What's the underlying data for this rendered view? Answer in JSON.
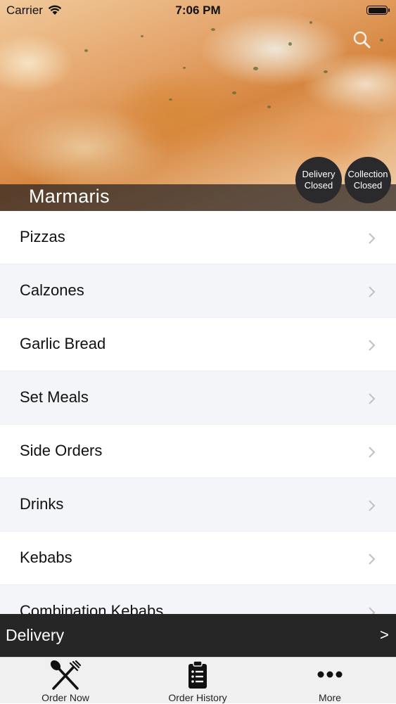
{
  "status_bar": {
    "carrier": "Carrier",
    "time": "7:06 PM"
  },
  "restaurant": {
    "name": "Marmaris"
  },
  "status": {
    "delivery": {
      "line1": "Delivery",
      "line2": "Closed"
    },
    "collection": {
      "line1": "Collection",
      "line2": "Closed"
    }
  },
  "menu": {
    "items": [
      {
        "label": "Pizzas"
      },
      {
        "label": "Calzones"
      },
      {
        "label": "Garlic Bread"
      },
      {
        "label": "Set Meals"
      },
      {
        "label": "Side Orders"
      },
      {
        "label": "Drinks"
      },
      {
        "label": "Kebabs"
      },
      {
        "label": "Combination Kebabs"
      }
    ]
  },
  "delivery_bar": {
    "label": "Delivery",
    "arrow": ">"
  },
  "tabs": [
    {
      "label": "Order Now",
      "icon": "fork-knife-icon"
    },
    {
      "label": "Order History",
      "icon": "clipboard-list-icon"
    },
    {
      "label": "More",
      "icon": "more-dots-icon"
    }
  ],
  "colors": {
    "bar": "#262626",
    "alt_row": "#f3f5f8",
    "circle": "#2a2a2c"
  }
}
